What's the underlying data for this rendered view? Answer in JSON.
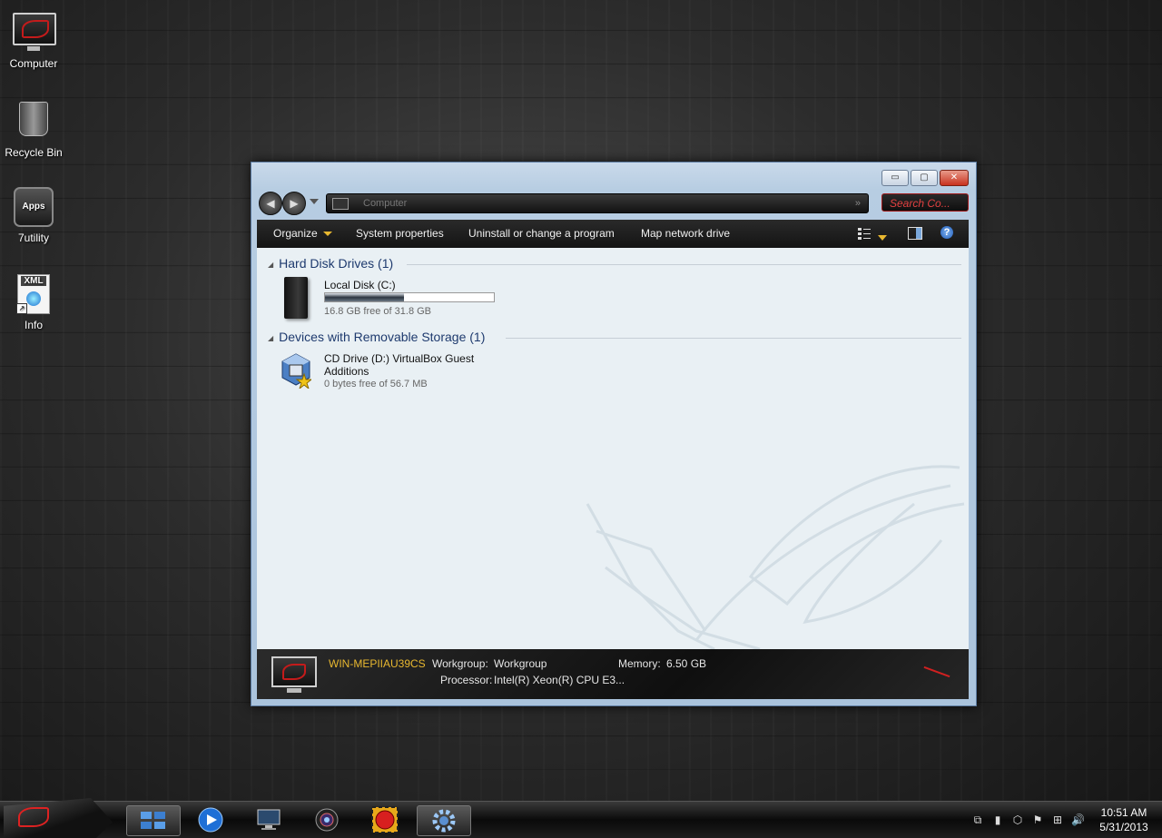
{
  "desktop": {
    "icons": [
      {
        "label": "Computer"
      },
      {
        "label": "Recycle Bin"
      },
      {
        "label": "7utility",
        "badge": "Apps"
      },
      {
        "label": "Info",
        "badge": "XML"
      }
    ]
  },
  "window": {
    "controls": {
      "minimize": "▭",
      "maximize": "▢",
      "close": "✕"
    },
    "address": {
      "text": "Computer",
      "end": "»"
    },
    "search": {
      "placeholder": "Search Co..."
    },
    "toolbar": {
      "organize": "Organize",
      "system_properties": "System properties",
      "uninstall": "Uninstall or change a program",
      "map_drive": "Map network drive",
      "help": "?"
    },
    "groups": [
      {
        "title": "Hard Disk Drives (1)",
        "drives": [
          {
            "name": "Local Disk (C:)",
            "free_text": "16.8 GB free of 31.8 GB",
            "used_fraction": 0.47
          }
        ]
      },
      {
        "title": "Devices with Removable Storage (1)",
        "drives": [
          {
            "name_line1": "CD Drive (D:) VirtualBox Guest",
            "name_line2": "Additions",
            "free_text": "0 bytes free of 56.7 MB"
          }
        ]
      }
    ],
    "details": {
      "computer_name": "WIN-MEPIIAU39CS",
      "workgroup_label": "Workgroup:",
      "workgroup_value": "Workgroup",
      "memory_label": "Memory:",
      "memory_value": "6.50 GB",
      "processor_label": "Processor:",
      "processor_value": "Intel(R) Xeon(R) CPU E3..."
    }
  },
  "taskbar": {
    "time": "10:51 AM",
    "date": "5/31/2013"
  },
  "colors": {
    "accent_red": "#c41b1b",
    "accent_gold": "#e8b830",
    "group_header": "#1e3a6e"
  }
}
